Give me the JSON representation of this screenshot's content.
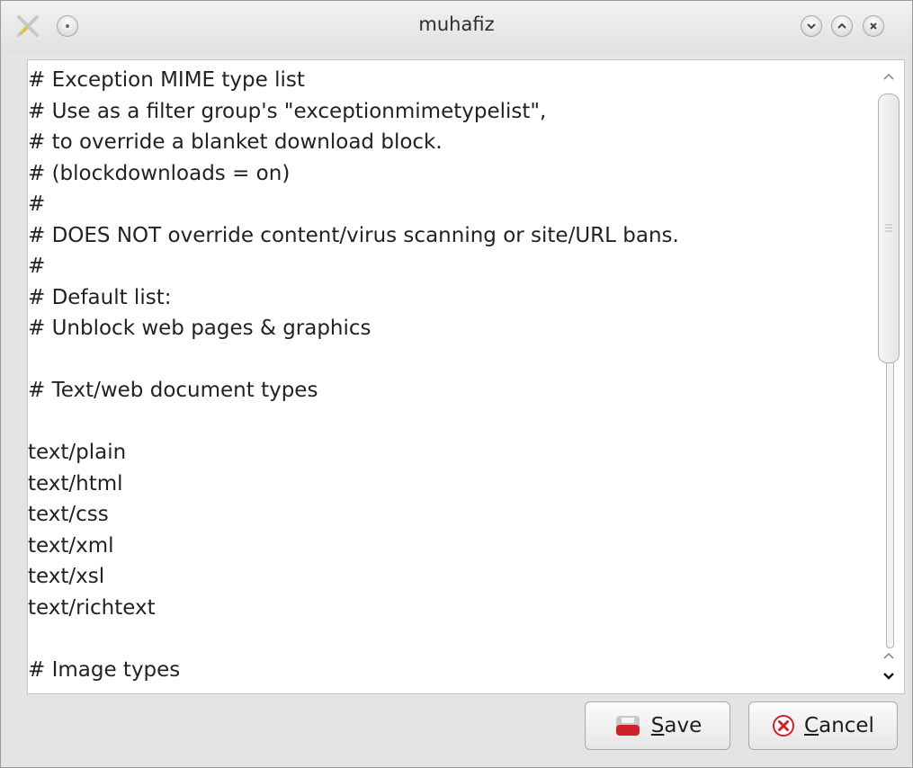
{
  "window": {
    "title": "muhafiz"
  },
  "editor": {
    "lines": [
      "# Exception MIME type list",
      "# Use as a filter group's \"exceptionmimetypelist\",",
      "# to override a blanket download block.",
      "# (blockdownloads = on)",
      "#",
      "# DOES NOT override content/virus scanning or site/URL bans.",
      "#",
      "# Default list:",
      "# Unblock web pages & graphics",
      "",
      "# Text/web document types",
      "",
      "text/plain",
      "text/html",
      "text/css",
      "text/xml",
      "text/xsl",
      "text/richtext",
      "",
      "# Image types"
    ]
  },
  "buttons": {
    "save": {
      "label_first": "S",
      "label_rest": "ave"
    },
    "cancel": {
      "label_first": "C",
      "label_rest": "ancel"
    }
  },
  "colors": {
    "accent_red": "#d0202a",
    "title_bar": "#e8e8e8"
  }
}
